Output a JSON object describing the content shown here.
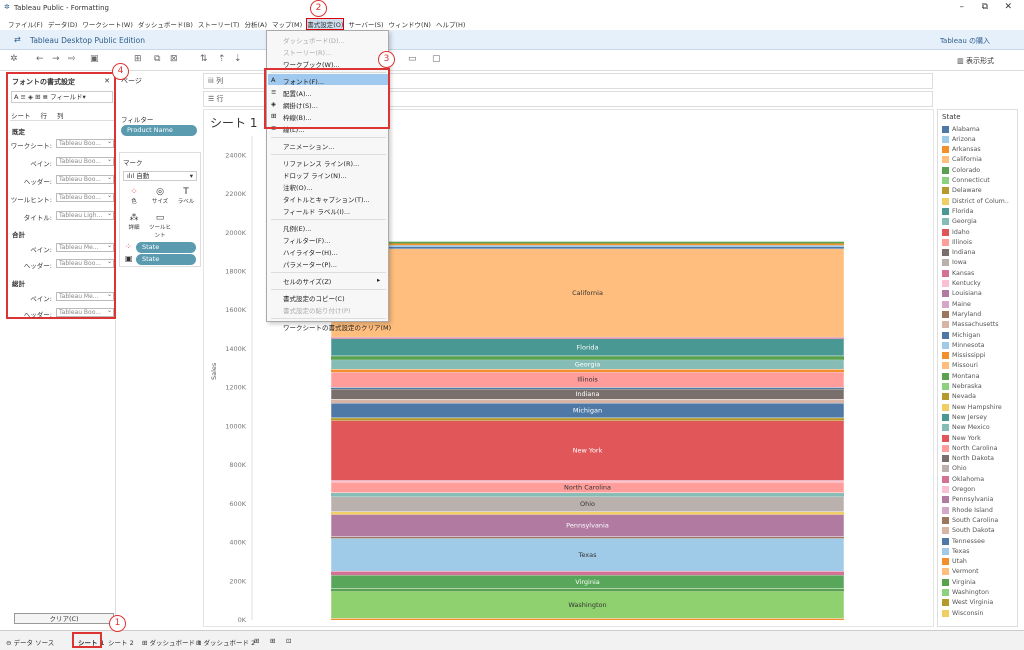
{
  "window": {
    "title": "Tableau Public - Formatting",
    "edition": "Tableau Desktop Public Edition",
    "buy": "Tableau の購入",
    "show_me": "表示形式"
  },
  "menubar": [
    "ファイル(F)",
    "データ(D)",
    "ワークシート(W)",
    "ダッシュボード(B)",
    "ストーリー(T)",
    "分析(A)",
    "マップ(M)",
    "書式設定(O)",
    "サーバー(S)",
    "ウィンドウ(N)",
    "ヘルプ(H)"
  ],
  "format_menu": {
    "items": [
      {
        "label": "ダッシュボード(D)...",
        "disabled": true
      },
      {
        "label": "ストーリー(R)...",
        "disabled": true
      },
      {
        "label": "ワークブック(W)...",
        "disabled": false
      },
      {
        "label": "フォント(F)...",
        "disabled": false,
        "icon": "A"
      },
      {
        "label": "配置(A)...",
        "disabled": false,
        "icon": "≡"
      },
      {
        "label": "網掛け(S)...",
        "disabled": false,
        "icon": "◈"
      },
      {
        "label": "枠線(B)...",
        "disabled": false,
        "icon": "⊞"
      },
      {
        "label": "線(L)...",
        "disabled": false,
        "icon": "≣"
      },
      {
        "label": "アニメーション...",
        "disabled": false
      },
      {
        "label": "リファレンス ライン(R)...",
        "disabled": false
      },
      {
        "label": "ドロップ ライン(N)...",
        "disabled": false
      },
      {
        "label": "注釈(O)...",
        "disabled": false
      },
      {
        "label": "タイトルとキャプション(T)...",
        "disabled": false
      },
      {
        "label": "フィールド ラベル(I)...",
        "disabled": false
      },
      {
        "label": "凡例(E)...",
        "disabled": false
      },
      {
        "label": "フィルター(F)...",
        "disabled": false
      },
      {
        "label": "ハイライター(H)...",
        "disabled": false
      },
      {
        "label": "パラメーター(P)...",
        "disabled": false
      },
      {
        "label": "セルのサイズ(Z)",
        "disabled": false,
        "submenu": true
      },
      {
        "label": "書式設定のコピー(C)",
        "disabled": false
      },
      {
        "label": "書式設定の貼り付け(P)",
        "disabled": true
      },
      {
        "label": "ワークシートの書式設定のクリア(M)",
        "disabled": false
      }
    ]
  },
  "callouts": [
    "1",
    "2",
    "3",
    "4"
  ],
  "font_pane": {
    "title": "フォントの書式設定",
    "field_label": "フィールド",
    "tabs": [
      "シート",
      "行",
      "列"
    ],
    "sections": [
      {
        "heading": "既定",
        "rows": [
          {
            "label": "ワークシート:",
            "value": "Tableau Boo..."
          },
          {
            "label": "ペイン:",
            "value": "Tableau Boo..."
          },
          {
            "label": "ヘッダー:",
            "value": "Tableau Boo..."
          },
          {
            "label": "ツールヒント:",
            "value": "Tableau Boo..."
          },
          {
            "label": "タイトル:",
            "value": "Tableau Ligh..."
          }
        ]
      },
      {
        "heading": "合計",
        "rows": [
          {
            "label": "ペイン:",
            "value": "Tableau Me..."
          },
          {
            "label": "ヘッダー:",
            "value": "Tableau Boo..."
          }
        ]
      },
      {
        "heading": "総計",
        "rows": [
          {
            "label": "ペイン:",
            "value": "Tableau Me..."
          },
          {
            "label": "ヘッダー:",
            "value": "Tableau Boo..."
          }
        ]
      }
    ],
    "clear_button": "クリア(C)"
  },
  "pages_label": "ページ",
  "filters": {
    "label": "フィルター",
    "pill": "Product Name"
  },
  "marks": {
    "label": "マーク",
    "type": "自動",
    "buttons": [
      "色",
      "サイズ",
      "ラベル",
      "詳細",
      "ツールヒント"
    ],
    "pills": [
      "State",
      "State"
    ]
  },
  "shelves": {
    "columns": "列",
    "rows": "行"
  },
  "sheet": {
    "title": "シート 1",
    "ylabel": "Sales"
  },
  "chart_data": {
    "type": "bar",
    "stacked": true,
    "ylabel": "Sales",
    "ylim": [
      0,
      2500000
    ],
    "yticks": [
      "0K",
      "200K",
      "400K",
      "600K",
      "800K",
      "1000K",
      "1200K",
      "1400K",
      "1600K",
      "1800K",
      "2000K",
      "2200K",
      "2400K"
    ],
    "segments_labeled": [
      "California",
      "Florida",
      "Georgia",
      "Illinois",
      "Indiana",
      "Michigan",
      "New York",
      "North Carolina",
      "Ohio",
      "Pennsylvania",
      "Texas",
      "Virginia",
      "Washington"
    ],
    "series": [
      {
        "name": "Washington",
        "value": 140000,
        "color": "#8fd16f"
      },
      {
        "name": "Virginia",
        "value": 70000,
        "color": "#57a659"
      },
      {
        "name": "Texas",
        "value": 170000,
        "color": "#a0cbe8"
      },
      {
        "name": "Pennsylvania",
        "value": 115000,
        "color": "#b07aa1"
      },
      {
        "name": "Ohio",
        "value": 78000,
        "color": "#bab0ac"
      },
      {
        "name": "North Carolina",
        "value": 55000,
        "color": "#ff9d9a"
      },
      {
        "name": "New York",
        "value": 310000,
        "color": "#e15759"
      },
      {
        "name": "Michigan",
        "value": 76000,
        "color": "#4e79a7"
      },
      {
        "name": "Indiana",
        "value": 53000,
        "color": "#79706e"
      },
      {
        "name": "Illinois",
        "value": 80000,
        "color": "#ff9d9a"
      },
      {
        "name": "Georgia",
        "value": 49000,
        "color": "#86bcb6"
      },
      {
        "name": "Florida",
        "value": 89000,
        "color": "#499894"
      },
      {
        "name": "California",
        "value": 457000,
        "color": "#ffbe7d"
      }
    ]
  },
  "legend": {
    "title": "State",
    "items": [
      {
        "name": "Alabama",
        "color": "#4e79a7"
      },
      {
        "name": "Arizona",
        "color": "#a0cbe8"
      },
      {
        "name": "Arkansas",
        "color": "#f28e2b"
      },
      {
        "name": "California",
        "color": "#ffbe7d"
      },
      {
        "name": "Colorado",
        "color": "#59a14f"
      },
      {
        "name": "Connecticut",
        "color": "#8cd17d"
      },
      {
        "name": "Delaware",
        "color": "#b6992d"
      },
      {
        "name": "District of Colum..",
        "color": "#f1ce63"
      },
      {
        "name": "Florida",
        "color": "#499894"
      },
      {
        "name": "Georgia",
        "color": "#86bcb6"
      },
      {
        "name": "Idaho",
        "color": "#e15759"
      },
      {
        "name": "Illinois",
        "color": "#ff9d9a"
      },
      {
        "name": "Indiana",
        "color": "#79706e"
      },
      {
        "name": "Iowa",
        "color": "#bab0ac"
      },
      {
        "name": "Kansas",
        "color": "#d37295"
      },
      {
        "name": "Kentucky",
        "color": "#fabfd2"
      },
      {
        "name": "Louisiana",
        "color": "#b07aa1"
      },
      {
        "name": "Maine",
        "color": "#d4a6c8"
      },
      {
        "name": "Maryland",
        "color": "#9d7660"
      },
      {
        "name": "Massachusetts",
        "color": "#d7b5a6"
      },
      {
        "name": "Michigan",
        "color": "#4e79a7"
      },
      {
        "name": "Minnesota",
        "color": "#a0cbe8"
      },
      {
        "name": "Mississippi",
        "color": "#f28e2b"
      },
      {
        "name": "Missouri",
        "color": "#ffbe7d"
      },
      {
        "name": "Montana",
        "color": "#59a14f"
      },
      {
        "name": "Nebraska",
        "color": "#8cd17d"
      },
      {
        "name": "Nevada",
        "color": "#b6992d"
      },
      {
        "name": "New Hampshire",
        "color": "#f1ce63"
      },
      {
        "name": "New Jersey",
        "color": "#499894"
      },
      {
        "name": "New Mexico",
        "color": "#86bcb6"
      },
      {
        "name": "New York",
        "color": "#e15759"
      },
      {
        "name": "North Carolina",
        "color": "#ff9d9a"
      },
      {
        "name": "North Dakota",
        "color": "#79706e"
      },
      {
        "name": "Ohio",
        "color": "#bab0ac"
      },
      {
        "name": "Oklahoma",
        "color": "#d37295"
      },
      {
        "name": "Oregon",
        "color": "#fabfd2"
      },
      {
        "name": "Pennsylvania",
        "color": "#b07aa1"
      },
      {
        "name": "Rhode Island",
        "color": "#d4a6c8"
      },
      {
        "name": "South Carolina",
        "color": "#9d7660"
      },
      {
        "name": "South Dakota",
        "color": "#d7b5a6"
      },
      {
        "name": "Tennessee",
        "color": "#4e79a7"
      },
      {
        "name": "Texas",
        "color": "#a0cbe8"
      },
      {
        "name": "Utah",
        "color": "#f28e2b"
      },
      {
        "name": "Vermont",
        "color": "#ffbe7d"
      },
      {
        "name": "Virginia",
        "color": "#59a14f"
      },
      {
        "name": "Washington",
        "color": "#8cd17d"
      },
      {
        "name": "West Virginia",
        "color": "#b6992d"
      },
      {
        "name": "Wisconsin",
        "color": "#f1ce63"
      }
    ]
  },
  "statusbar": {
    "datasource": "データ ソース",
    "tabs": [
      "シート 1",
      "シート 2",
      "ダッシュボード 1",
      "ダッシュボード 2"
    ]
  }
}
